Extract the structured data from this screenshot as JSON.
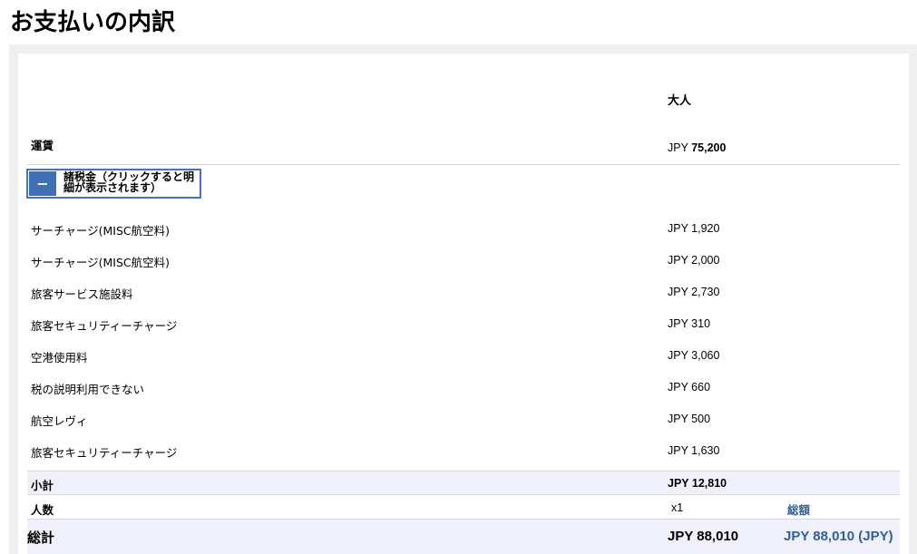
{
  "page": {
    "title": "お支払いの内訳"
  },
  "table": {
    "column_header": "大人",
    "fare": {
      "label": "運賃",
      "currency": "JPY",
      "amount": "75,200"
    },
    "taxes_toggle": {
      "icon": "−",
      "label": "諸税金（クリックすると明細が表示されます）"
    },
    "tax_items": [
      {
        "label": "サーチャージ(MISC航空料)",
        "amount": "JPY 1,920"
      },
      {
        "label": "サーチャージ(MISC航空料)",
        "amount": "JPY 2,000"
      },
      {
        "label": "旅客サービス施設料",
        "amount": "JPY 2,730"
      },
      {
        "label": "旅客セキュリティーチャージ",
        "amount": "JPY 310"
      },
      {
        "label": "空港使用料",
        "amount": "JPY 3,060"
      },
      {
        "label": "税の説明利用できない",
        "amount": "JPY 660"
      },
      {
        "label": "航空レヴィ",
        "amount": "JPY 500"
      },
      {
        "label": "旅客セキュリティーチャージ",
        "amount": "JPY 1,630"
      }
    ],
    "subtotal": {
      "label": "小計",
      "amount": "JPY 12,810"
    },
    "pax": {
      "label": "人数",
      "count": "x1",
      "total_header": "総額"
    },
    "grand_total": {
      "label": "総計",
      "amount": "JPY 88,010",
      "total": "JPY 88,010 (JPY)"
    }
  },
  "colors": {
    "accent": "#3f6fb5",
    "link": "#2f5f9e",
    "band": "#f0f0fb",
    "frame": "#efefef"
  }
}
